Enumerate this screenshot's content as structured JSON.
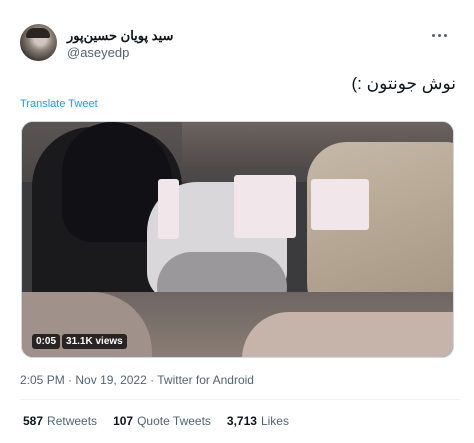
{
  "author": {
    "display_name": "سید پویان حسین‌پور",
    "handle": "@aseyedp"
  },
  "tweet": {
    "text": "نوش جونتون :)",
    "translate_label": "Translate Tweet"
  },
  "media": {
    "duration": "0:05",
    "views": "31.1K views"
  },
  "meta": {
    "time": "2:05 PM",
    "date": "Nov 19, 2022",
    "source": "Twitter for Android",
    "separator": "·"
  },
  "stats": {
    "retweets": {
      "count": "587",
      "label": "Retweets"
    },
    "quotes": {
      "count": "107",
      "label": "Quote Tweets"
    },
    "likes": {
      "count": "3,713",
      "label": "Likes"
    }
  },
  "colors": {
    "link": "#1d9bf0",
    "muted": "#536471",
    "text": "#0f1419"
  }
}
